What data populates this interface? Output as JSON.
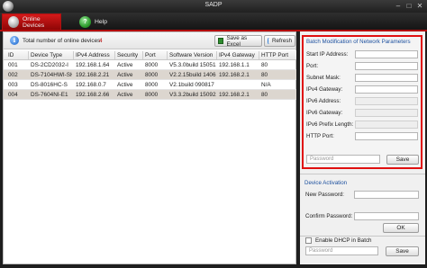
{
  "window": {
    "title": "SADP",
    "controls": [
      "–",
      "□",
      "✕"
    ]
  },
  "tabs": [
    {
      "label": "Online Devices",
      "icon": "device-icon",
      "active": true
    },
    {
      "label": "Help",
      "icon": "help-icon",
      "active": false
    }
  ],
  "toolbar": {
    "total_label": "Total number of online devices:",
    "total_count": "4",
    "save_label": "Save as Excel",
    "refresh_label": "Refresh"
  },
  "table": {
    "columns": [
      "ID",
      "Device Type",
      "IPv4 Address",
      "Security",
      "Port",
      "Software Version",
      "IPv4 Gateway",
      "HTTP Port"
    ],
    "rows": [
      [
        "001",
        "DS-2CD2032-I",
        "192.168.1.64",
        "Active",
        "8000",
        "V5.3.0build 150513",
        "192.168.1.1",
        "80"
      ],
      [
        "002",
        "DS-7104HWI-SH",
        "192.168.2.21",
        "Active",
        "8000",
        "V2.2.15build 140618",
        "192.168.2.1",
        "80"
      ],
      [
        "003",
        "DS-8016HC-S",
        "192.168.0.7",
        "Active",
        "8000",
        "V2.1build 090817",
        "",
        "N/A"
      ],
      [
        "004",
        "DS-7604NI-E1",
        "192.168.2.66",
        "Active",
        "8000",
        "V3.3.2build 150922",
        "192.168.2.1",
        "80"
      ]
    ]
  },
  "batch": {
    "title": "Batch Modification of Network Parameters",
    "fields": [
      {
        "label": "Start IP Address:",
        "enabled": true
      },
      {
        "label": "Port:",
        "enabled": true
      },
      {
        "label": "Subnet Mask:",
        "enabled": true
      },
      {
        "label": "IPv4 Gateway:",
        "enabled": true
      },
      {
        "label": "IPv6 Address:",
        "enabled": false
      },
      {
        "label": "IPv6 Gateway:",
        "enabled": false
      },
      {
        "label": "IPv6 Prefix Length:",
        "enabled": false
      },
      {
        "label": "HTTP Port:",
        "enabled": true
      }
    ],
    "password_placeholder": "Password",
    "save_label": "Save"
  },
  "activation": {
    "title": "Device Activation",
    "new_password_label": "New Password:",
    "confirm_password_label": "Confirm Password:",
    "ok_label": "OK",
    "dhcp_label": "Enable DHCP in Batch",
    "password_placeholder": "Password",
    "save_label": "Save"
  },
  "colors": {
    "accent_red": "#d41a1a",
    "highlight_border": "#e01010",
    "row_alt": "#dcd6cf",
    "section_title": "#1b4f9e"
  }
}
